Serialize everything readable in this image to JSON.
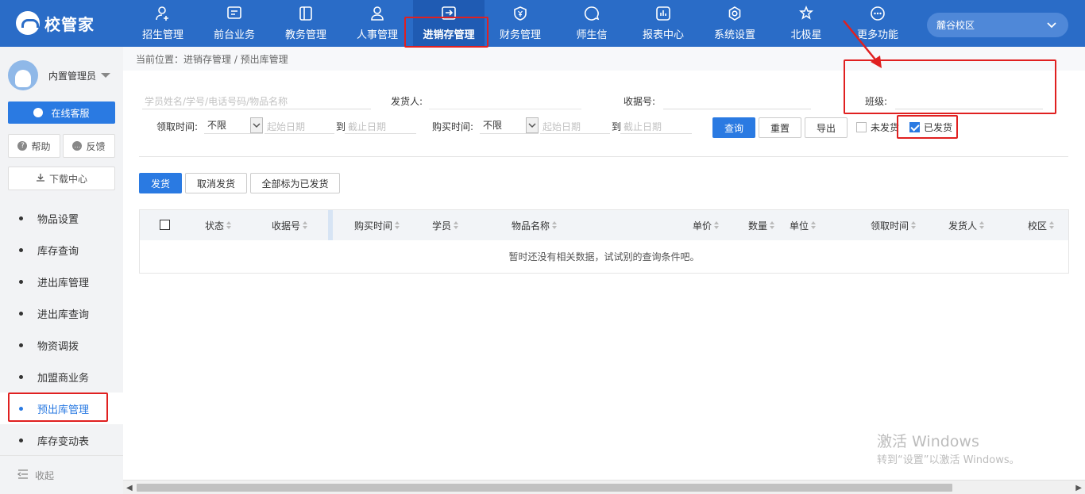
{
  "app": {
    "logo_text": "校管家"
  },
  "nav": {
    "items": [
      {
        "label": "招生管理",
        "icon": "user-plus-icon"
      },
      {
        "label": "前台业务",
        "icon": "monitor-icon"
      },
      {
        "label": "教务管理",
        "icon": "book-icon"
      },
      {
        "label": "人事管理",
        "icon": "person-icon"
      },
      {
        "label": "进销存管理",
        "icon": "exchange-box-icon",
        "active": true
      },
      {
        "label": "财务管理",
        "icon": "yuan-shield-icon"
      },
      {
        "label": "师生信",
        "icon": "chat-icon"
      },
      {
        "label": "报表中心",
        "icon": "bar-chart-icon"
      },
      {
        "label": "系统设置",
        "icon": "gear-icon"
      },
      {
        "label": "北极星",
        "icon": "star-icon"
      },
      {
        "label": "更多功能",
        "icon": "more-icon"
      }
    ],
    "campus": "麓谷校区"
  },
  "sidebar": {
    "user_name": "内置管理员",
    "online_service": "在线客服",
    "help": "帮助",
    "feedback": "反馈",
    "download_center": "下载中心",
    "menu": [
      {
        "label": "物品设置"
      },
      {
        "label": "库存查询"
      },
      {
        "label": "进出库管理"
      },
      {
        "label": "进出库查询"
      },
      {
        "label": "物资调拨"
      },
      {
        "label": "加盟商业务"
      },
      {
        "label": "预出库管理",
        "active": true
      },
      {
        "label": "库存变动表"
      }
    ],
    "collapse": "收起"
  },
  "breadcrumb": "当前位置：进销存管理 / 预出库管理",
  "filters": {
    "search_placeholder": "学员姓名/学号/电话号码/物品名称",
    "sender_label": "发货人:",
    "receipt_label": "收据号:",
    "class_label": "班级:",
    "receive_time_label": "领取时间:",
    "receive_time_value": "不限",
    "start_date_placeholder": "起始日期",
    "to_label": "到",
    "end_date_placeholder": "截止日期",
    "purchase_time_label": "购买时间:",
    "purchase_time_value": "不限",
    "query_button": "查询",
    "reset_button": "重置",
    "export_button": "导出",
    "not_shipped_label": "未发货",
    "shipped_label": "已发货",
    "not_shipped_checked": false,
    "shipped_checked": true
  },
  "actions": {
    "ship": "发货",
    "cancel_ship": "取消发货",
    "mark_all_shipped": "全部标为已发货"
  },
  "table": {
    "columns": [
      "状态",
      "收据号",
      "购买时间",
      "学员",
      "物品名称",
      "单价",
      "数量",
      "单位",
      "领取时间",
      "发货人",
      "校区"
    ],
    "empty_text": "暂时还没有相关数据，试试别的查询条件吧。"
  },
  "watermark": {
    "title": "激活 Windows",
    "subtitle": "转到“设置”以激活 Windows。"
  },
  "colors": {
    "topbar": "#2a6cc7",
    "primary": "#2a7ae2",
    "annotation_red": "#e02020"
  }
}
